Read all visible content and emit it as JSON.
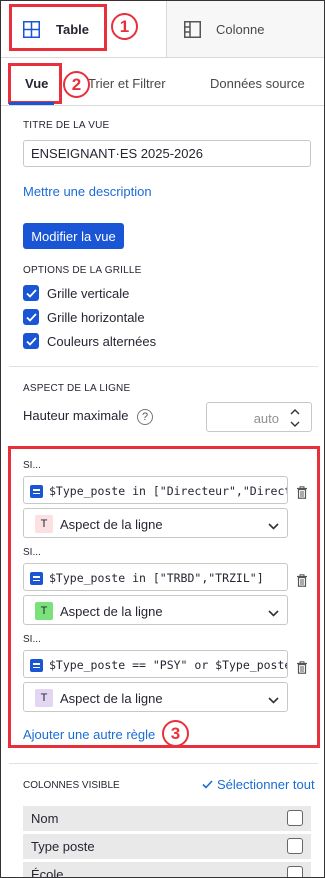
{
  "tabs": {
    "table": "Table",
    "colonne": "Colonne"
  },
  "subtabs": {
    "vue": "Vue",
    "trier": "Trier et Filtrer",
    "source": "Données source"
  },
  "annotations": {
    "one": "1",
    "two": "2",
    "three": "3"
  },
  "view": {
    "title_label": "TITRE DE LA VUE",
    "title_value": "ENSEIGNANT·ES 2025-2026",
    "description_link": "Mettre une description",
    "edit_button": "Modifier la vue"
  },
  "grid": {
    "label": "OPTIONS DE LA GRILLE",
    "options": [
      {
        "label": "Grille verticale",
        "checked": true
      },
      {
        "label": "Grille horizontale",
        "checked": true
      },
      {
        "label": "Couleurs alternées",
        "checked": true
      }
    ]
  },
  "row_style": {
    "label": "ASPECT DE LA LIGNE",
    "max_height_label": "Hauteur maximale",
    "help": "?",
    "max_height_value": "auto"
  },
  "rules": [
    {
      "si": "SI...",
      "formula": "$Type_poste in [\"Directeur\",\"Directrice\"]",
      "swatch": "T",
      "swatch_color": "#fbe1e1",
      "style_label": "Aspect de la ligne"
    },
    {
      "si": "SI...",
      "formula": "$Type_poste in [\"TRBD\",\"TRZIL\"]",
      "swatch": "T",
      "swatch_color": "#7be27b",
      "style_label": "Aspect de la ligne"
    },
    {
      "si": "SI...",
      "formula": "$Type_poste == \"PSY\" or $Type_poste == \"PSYEN\"",
      "swatch": "T",
      "swatch_color": "#e2d6f3",
      "style_label": "Aspect de la ligne"
    }
  ],
  "add_rule": "Ajouter une autre règle",
  "columns": {
    "label": "COLONNES VISIBLE",
    "select_all": "Sélectionner tout",
    "items": [
      "Nom",
      "Type poste",
      "École"
    ]
  },
  "colors": {
    "accent": "#1a55d6",
    "annotation": "#e8303d",
    "active_tab": "#16b378"
  }
}
